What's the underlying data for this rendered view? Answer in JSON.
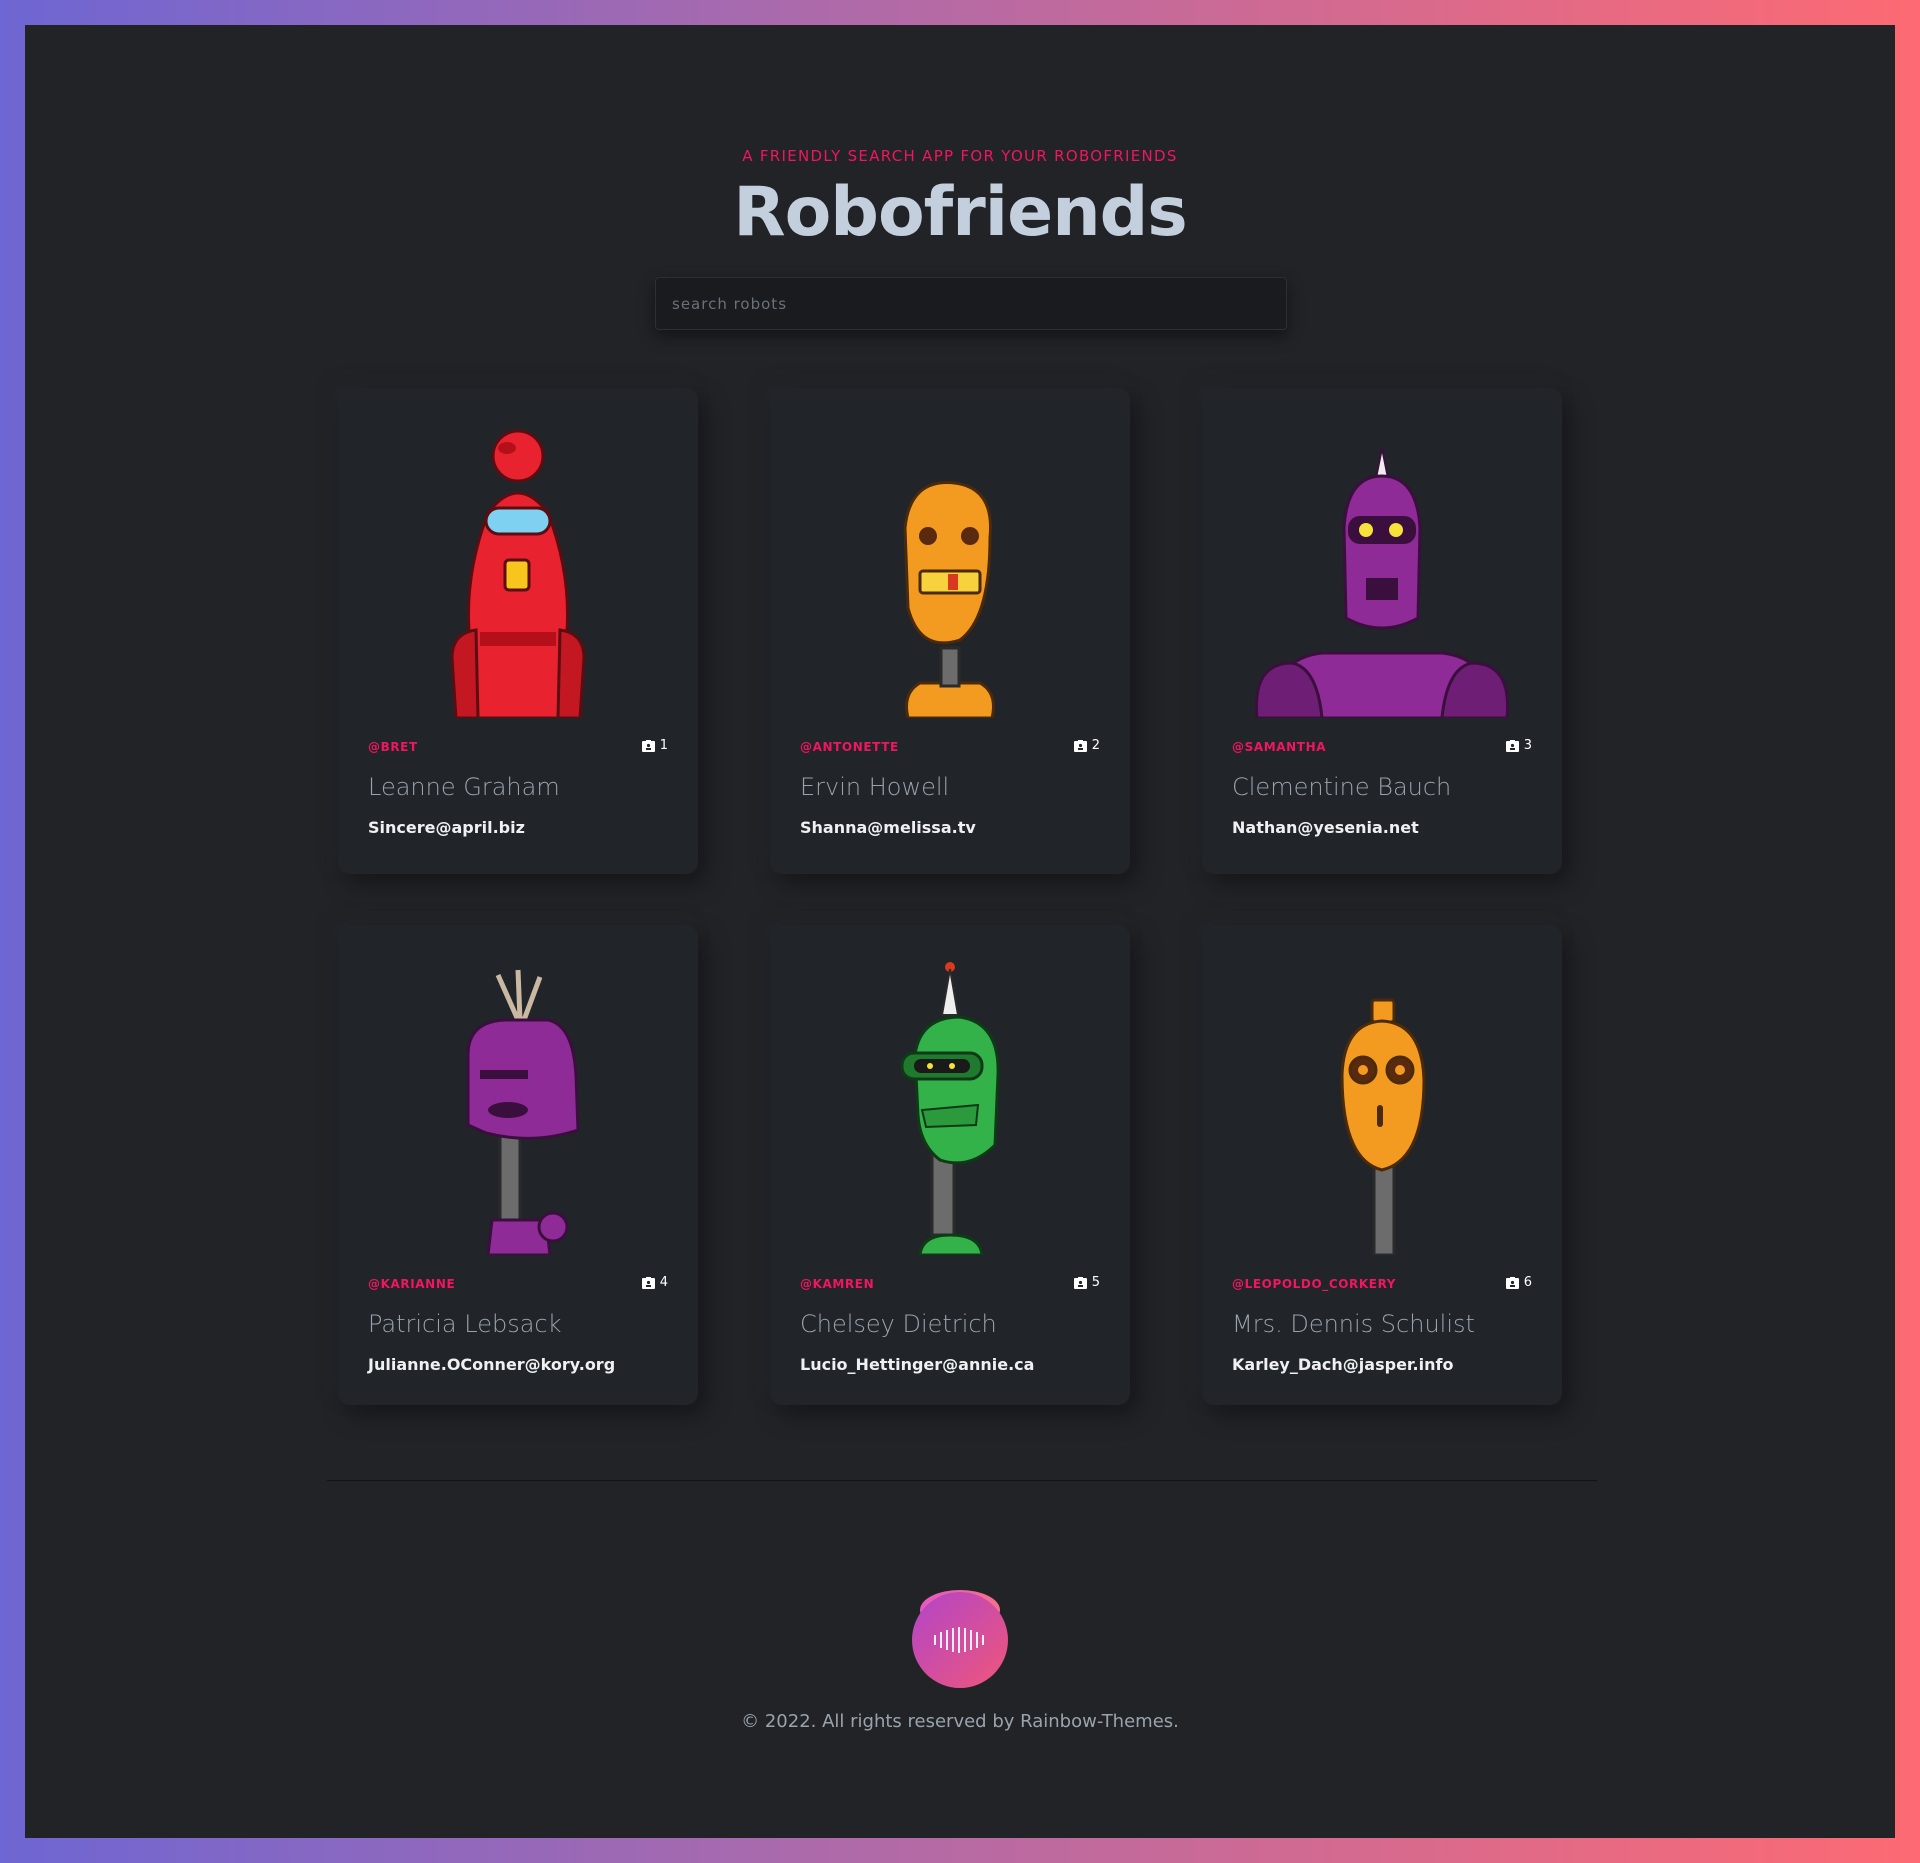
{
  "header": {
    "tagline": "A FRIENDLY SEARCH APP FOR YOUR ROBOFRIENDS",
    "title": "Robofriends"
  },
  "search": {
    "placeholder": "search robots",
    "value": ""
  },
  "robots": [
    {
      "id": "1",
      "handle": "@BRET",
      "name": "Leanne Graham",
      "email": "Sincere@april.biz",
      "color": "#e8232f",
      "icon": "red-robot-avatar"
    },
    {
      "id": "2",
      "handle": "@ANTONETTE",
      "name": "Ervin Howell",
      "email": "Shanna@melissa.tv",
      "color": "#f39b21",
      "icon": "orange-robot-avatar"
    },
    {
      "id": "3",
      "handle": "@SAMANTHA",
      "name": "Clementine Bauch",
      "email": "Nathan@yesenia.net",
      "color": "#8e2b96",
      "icon": "purple-robot-avatar"
    },
    {
      "id": "4",
      "handle": "@KARIANNE",
      "name": "Patricia Lebsack",
      "email": "Julianne.OConner@kory.org",
      "color": "#8e2b96",
      "icon": "purple-robot-avatar"
    },
    {
      "id": "5",
      "handle": "@KAMREN",
      "name": "Chelsey Dietrich",
      "email": "Lucio_Hettinger@annie.ca",
      "color": "#34b24a",
      "icon": "green-robot-avatar"
    },
    {
      "id": "6",
      "handle": "@LEOPOLDO_CORKERY",
      "name": "Mrs. Dennis Schulist",
      "email": "Karley_Dach@jasper.info",
      "color": "#f39b21",
      "icon": "orange-robot-avatar"
    }
  ],
  "footer": {
    "copyright": "© 2022. All rights reserved by Rainbow-Themes.",
    "logo_icon": "rainbow-themes-logo"
  },
  "colors": {
    "accent": "#f0165f",
    "background": "#212327",
    "title": "#c4cfde"
  }
}
